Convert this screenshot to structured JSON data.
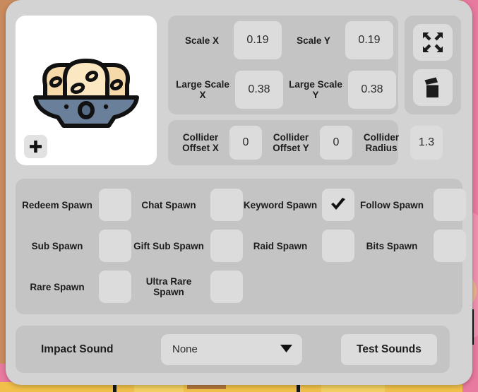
{
  "window": {
    "background_color": "#d3d3d3",
    "panel_color": "#c4c4c4",
    "control_color": "#dcdcdc"
  },
  "preview": {
    "add_button_icon": "plus-icon",
    "sprite_name": "bread-rolls-on-plate-sprite"
  },
  "tools": {
    "collapse_icon": "collapse-arrows-icon",
    "delete_icon": "trash-icon"
  },
  "scale_fields": [
    {
      "label": "Scale X",
      "value": "0.19"
    },
    {
      "label": "Scale Y",
      "value": "0.19"
    },
    {
      "label": "Large Scale X",
      "value": "0.38"
    },
    {
      "label": "Large Scale Y",
      "value": "0.38"
    }
  ],
  "collider_fields": [
    {
      "label": "Collider Offset X",
      "value": "0"
    },
    {
      "label": "Collider Offset Y",
      "value": "0"
    },
    {
      "label": "Collider Radius",
      "value": "1.3"
    }
  ],
  "spawn_toggles": [
    {
      "label": "Redeem Spawn",
      "checked": false
    },
    {
      "label": "Chat Spawn",
      "checked": false
    },
    {
      "label": "Keyword Spawn",
      "checked": true
    },
    {
      "label": "Follow Spawn",
      "checked": false
    },
    {
      "label": "Sub Spawn",
      "checked": false
    },
    {
      "label": "Gift Sub Spawn",
      "checked": false
    },
    {
      "label": "Raid Spawn",
      "checked": false
    },
    {
      "label": "Bits Spawn",
      "checked": false
    },
    {
      "label": "Rare Spawn",
      "checked": false
    },
    {
      "label": "Ultra Rare Spawn",
      "checked": false
    }
  ],
  "sound": {
    "label": "Impact Sound",
    "selected_option": "None",
    "options": [
      "None"
    ],
    "test_button_label": "Test Sounds",
    "caret_icon": "chevron-down-icon"
  }
}
